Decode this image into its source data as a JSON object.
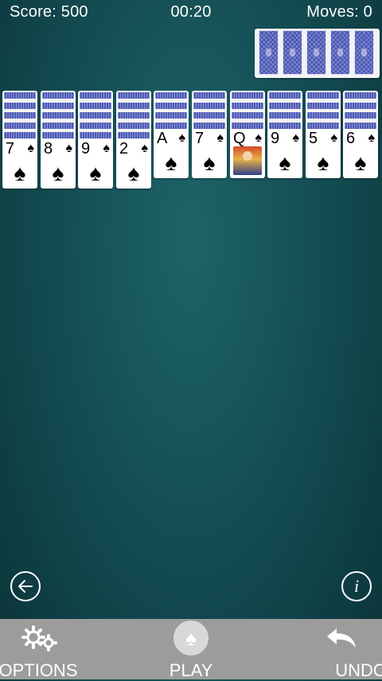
{
  "hud": {
    "score": "Score: 500",
    "time": "00:20",
    "moves": "Moves: 0"
  },
  "stock": {
    "count": 5
  },
  "tableau": [
    {
      "facedown": 5,
      "rank": "7",
      "suit": "♠"
    },
    {
      "facedown": 5,
      "rank": "8",
      "suit": "♠"
    },
    {
      "facedown": 5,
      "rank": "9",
      "suit": "♠"
    },
    {
      "facedown": 5,
      "rank": "2",
      "suit": "♠"
    },
    {
      "facedown": 4,
      "rank": "A",
      "suit": "♠"
    },
    {
      "facedown": 4,
      "rank": "7",
      "suit": "♠"
    },
    {
      "facedown": 4,
      "rank": "Q",
      "suit": "♠",
      "face": true
    },
    {
      "facedown": 4,
      "rank": "9",
      "suit": "♠"
    },
    {
      "facedown": 4,
      "rank": "5",
      "suit": "♠"
    },
    {
      "facedown": 4,
      "rank": "6",
      "suit": "♠"
    }
  ],
  "controls": {
    "back_icon": "arrow-left-icon",
    "info_glyph": "i"
  },
  "toolbar": {
    "options_label": "OPTIONS",
    "play_label": "PLAY",
    "undo_label": "UNDO",
    "play_glyph": "♠"
  }
}
